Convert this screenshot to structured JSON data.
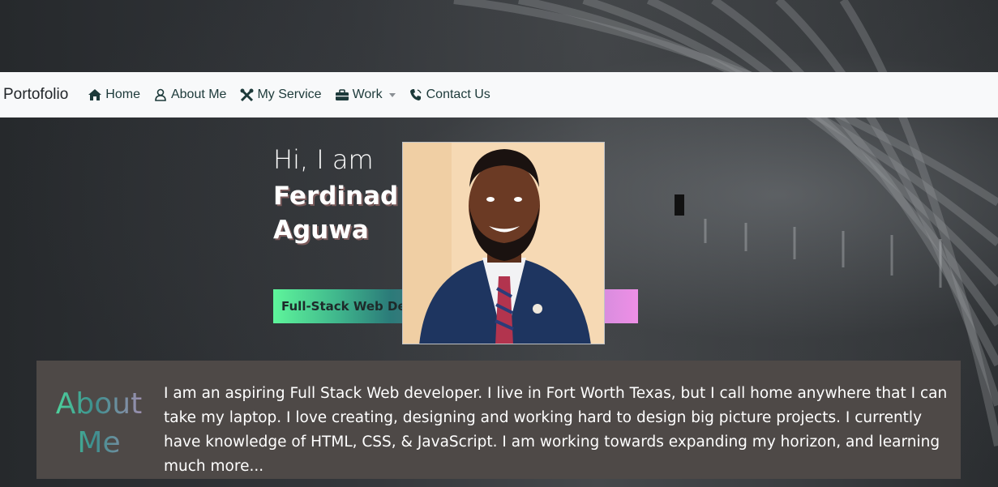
{
  "navbar": {
    "brand": "Portofolio",
    "items": [
      {
        "label": "Home",
        "icon": "home-icon"
      },
      {
        "label": "About Me",
        "icon": "user-icon"
      },
      {
        "label": "My Service",
        "icon": "tools-icon"
      },
      {
        "label": "Work",
        "icon": "briefcase-icon",
        "dropdown": true
      },
      {
        "label": "Contact Us",
        "icon": "phone-icon"
      }
    ]
  },
  "hero": {
    "greeting": "Hi, I am",
    "name_first": "Ferdinad",
    "name_last": "Aguwa",
    "role": "Full-Stack Web Dev",
    "portrait_alt": "portrait"
  },
  "about": {
    "title_line1": "About",
    "title_line2": "Me",
    "text": "I am an aspiring Full Stack Web developer. I live in Fort Worth Texas, but I call home anywhere that I can take my laptop. I love creating, designing and working hard to design big picture projects. I currently have knowledge of HTML, CSS, & JavaScript. I am working towards expanding my horizon, and learning much more..."
  },
  "colors": {
    "navbar_bg": "#f8f9fa",
    "nav_text": "#1d3a3a",
    "about_bg": "#4e4947",
    "role_gradient_start": "#5ef59b",
    "role_gradient_end": "#ee8fe6"
  }
}
